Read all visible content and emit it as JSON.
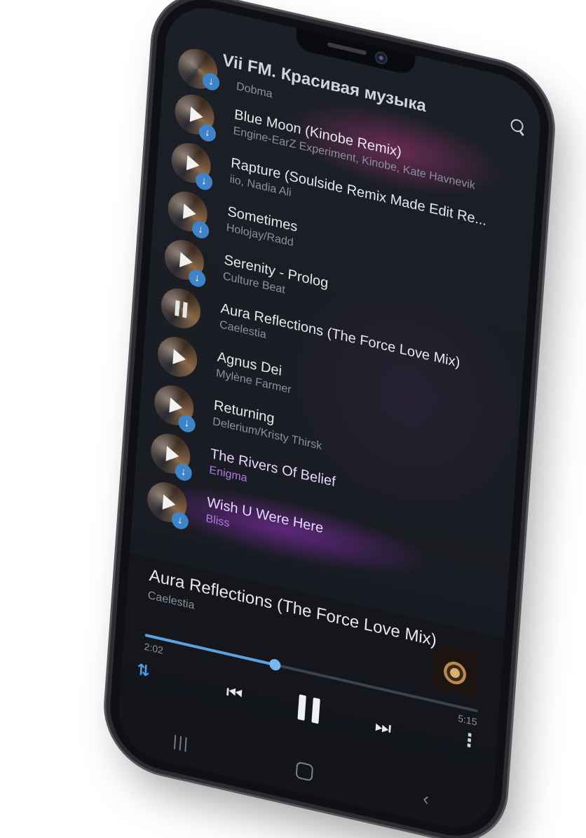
{
  "header": {
    "title": "Vii FM. Красивая музыка"
  },
  "tracks": [
    {
      "title": "",
      "artist": "Dobma",
      "state": "play",
      "downloaded": true
    },
    {
      "title": "Blue Moon (Kinobe Remix)",
      "artist": "Engine-EarZ Experiment, Kinobe, Kate Havnevik",
      "state": "play",
      "downloaded": true
    },
    {
      "title": "Rapture (Soulside Remix Made Edit Re...",
      "artist": "iio, Nadia Ali",
      "state": "play",
      "downloaded": true
    },
    {
      "title": "Sometimes",
      "artist": "Holojay/Radd",
      "state": "play",
      "downloaded": true
    },
    {
      "title": "Serenity - Prolog",
      "artist": "Culture Beat",
      "state": "play",
      "downloaded": true
    },
    {
      "title": "Aura Reflections (The Force Love Mix)",
      "artist": "Caelestia",
      "state": "paused",
      "downloaded": false
    },
    {
      "title": "Agnus Dei",
      "artist": "Mylène Farmer",
      "state": "play",
      "downloaded": false
    },
    {
      "title": "Returning",
      "artist": "Delerium/Kristy Thirsk",
      "state": "play",
      "downloaded": true
    },
    {
      "title": "The Rivers Of Belief",
      "artist": "Enigma",
      "state": "play",
      "downloaded": true
    },
    {
      "title": "Wish U Were Here",
      "artist": "Bliss",
      "state": "play",
      "downloaded": true
    }
  ],
  "now_playing": {
    "title": "Aura Reflections (The Force Love Mix)",
    "artist": "Caelestia",
    "elapsed": "2:02",
    "duration": "5:15",
    "progress": 0.39
  },
  "icons": {
    "back": "arrow-left-icon",
    "search": "search-icon",
    "download": "download-icon",
    "shuffle": "sort-icon",
    "prev": "skip-previous-icon",
    "pause": "pause-icon",
    "next": "skip-next-icon",
    "more": "more-vertical-icon"
  },
  "colors": {
    "accent": "#4d9ee6",
    "progress": "#5aa3df",
    "download_badge": "#3f83c9",
    "highlight_artist": "#b07ae0"
  }
}
